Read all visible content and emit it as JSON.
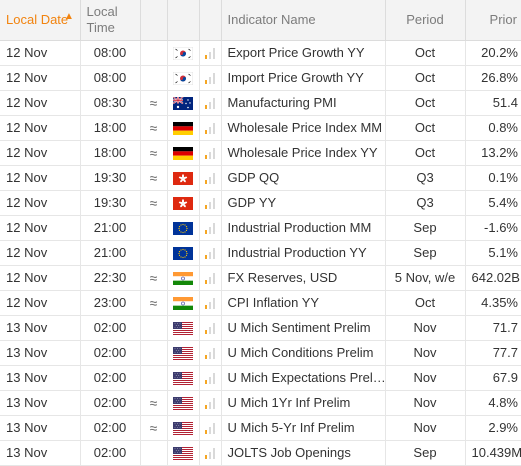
{
  "header": {
    "local_date": "Local Date",
    "local_time": "Local Time",
    "indicator_name": "Indicator Name",
    "period": "Period",
    "prior": "Prior"
  },
  "colors": {
    "accent": "#f2830e",
    "importance_on": "#f5a623",
    "importance_off": "#d9d9d9"
  },
  "rows": [
    {
      "date": "12 Nov",
      "time": "08:00",
      "approx": "",
      "flag": "south-korea",
      "importance": 1,
      "name": "Export Price Growth YY",
      "period": "Oct",
      "prior": "20.2%"
    },
    {
      "date": "12 Nov",
      "time": "08:00",
      "approx": "",
      "flag": "south-korea",
      "importance": 1,
      "name": "Import Price Growth YY",
      "period": "Oct",
      "prior": "26.8%"
    },
    {
      "date": "12 Nov",
      "time": "08:30",
      "approx": "≈",
      "flag": "australia",
      "importance": 1,
      "name": "Manufacturing PMI",
      "period": "Oct",
      "prior": "51.4"
    },
    {
      "date": "12 Nov",
      "time": "18:00",
      "approx": "≈",
      "flag": "germany",
      "importance": 1,
      "name": "Wholesale Price Index MM",
      "period": "Oct",
      "prior": "0.8%"
    },
    {
      "date": "12 Nov",
      "time": "18:00",
      "approx": "≈",
      "flag": "germany",
      "importance": 1,
      "name": "Wholesale Price Index YY",
      "period": "Oct",
      "prior": "13.2%"
    },
    {
      "date": "12 Nov",
      "time": "19:30",
      "approx": "≈",
      "flag": "hong-kong",
      "importance": 1,
      "name": "GDP QQ",
      "period": "Q3",
      "prior": "0.1%"
    },
    {
      "date": "12 Nov",
      "time": "19:30",
      "approx": "≈",
      "flag": "hong-kong",
      "importance": 1,
      "name": "GDP YY",
      "period": "Q3",
      "prior": "5.4%"
    },
    {
      "date": "12 Nov",
      "time": "21:00",
      "approx": "",
      "flag": "eu",
      "importance": 1,
      "name": "Industrial Production MM",
      "period": "Sep",
      "prior": "-1.6%"
    },
    {
      "date": "12 Nov",
      "time": "21:00",
      "approx": "",
      "flag": "eu",
      "importance": 1,
      "name": "Industrial Production YY",
      "period": "Sep",
      "prior": "5.1%"
    },
    {
      "date": "12 Nov",
      "time": "22:30",
      "approx": "≈",
      "flag": "india",
      "importance": 1,
      "name": "FX Reserves, USD",
      "period": "5 Nov, w/e",
      "prior": "642.02B"
    },
    {
      "date": "12 Nov",
      "time": "23:00",
      "approx": "≈",
      "flag": "india",
      "importance": 1,
      "name": "CPI Inflation YY",
      "period": "Oct",
      "prior": "4.35%"
    },
    {
      "date": "13 Nov",
      "time": "02:00",
      "approx": "",
      "flag": "usa",
      "importance": 1,
      "name": "U Mich Sentiment Prelim",
      "period": "Nov",
      "prior": "71.7"
    },
    {
      "date": "13 Nov",
      "time": "02:00",
      "approx": "",
      "flag": "usa",
      "importance": 1,
      "name": "U Mich Conditions Prelim",
      "period": "Nov",
      "prior": "77.7"
    },
    {
      "date": "13 Nov",
      "time": "02:00",
      "approx": "",
      "flag": "usa",
      "importance": 1,
      "name": "U Mich Expectations Prel…",
      "period": "Nov",
      "prior": "67.9"
    },
    {
      "date": "13 Nov",
      "time": "02:00",
      "approx": "≈",
      "flag": "usa",
      "importance": 1,
      "name": "U Mich 1Yr Inf Prelim",
      "period": "Nov",
      "prior": "4.8%"
    },
    {
      "date": "13 Nov",
      "time": "02:00",
      "approx": "≈",
      "flag": "usa",
      "importance": 1,
      "name": "U Mich 5-Yr Inf Prelim",
      "period": "Nov",
      "prior": "2.9%"
    },
    {
      "date": "13 Nov",
      "time": "02:00",
      "approx": "",
      "flag": "usa",
      "importance": 1,
      "name": "JOLTS Job Openings",
      "period": "Sep",
      "prior": "10.439M"
    }
  ]
}
